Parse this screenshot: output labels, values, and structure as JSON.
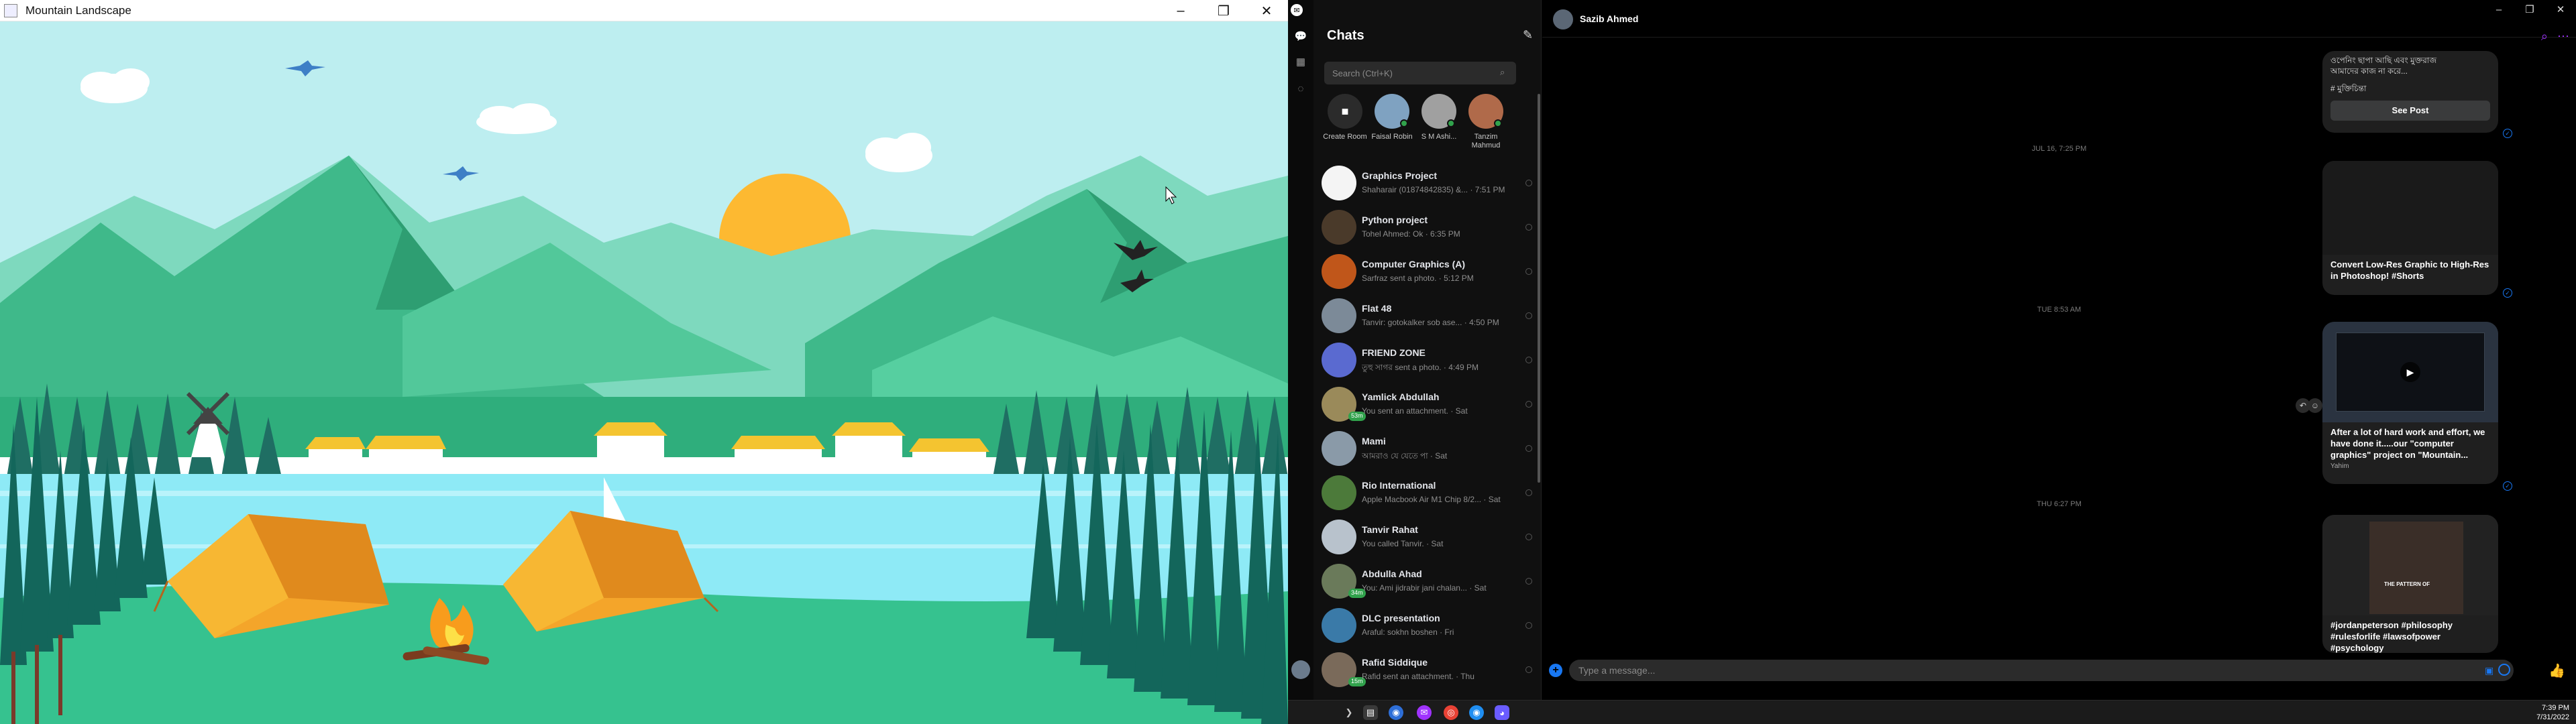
{
  "left_window": {
    "title": "Mountain Landscape",
    "controls": [
      "–",
      "❐",
      "✕"
    ]
  },
  "messenger": {
    "header_title": "Chats",
    "search_placeholder": "Search (Ctrl+K)",
    "stories": [
      {
        "label": "Create Room",
        "type": "create"
      },
      {
        "label": "Faisal Robin",
        "type": "person",
        "color": "#7fa2c1"
      },
      {
        "label": "S M Ashi...",
        "type": "person",
        "color": "#a0a0a0"
      },
      {
        "label": "Tanzim Mahmud",
        "type": "person",
        "color": "#b06a4a"
      }
    ],
    "conversations": [
      {
        "name": "Graphics Project",
        "preview": "Shaharair (01874842835) &... · 7:51 PM",
        "color": "#f4f4f4",
        "badge": ""
      },
      {
        "name": "Python project",
        "preview": "Tohel Ahmed: Ok · 6:35 PM",
        "color": "#4a3a2a",
        "badge": ""
      },
      {
        "name": "Computer Graphics (A)",
        "preview": "Sarfraz sent a photo. · 5:12 PM",
        "color": "#c0561a",
        "badge": ""
      },
      {
        "name": "Flat 48",
        "preview": "Tanvir: gotokalker sob ase... · 4:50 PM",
        "color": "#7c8a98",
        "badge": ""
      },
      {
        "name": "FRIEND ZONE",
        "preview": "তুহু সাগর sent a photo. · 4:49 PM",
        "color": "#5a6ad0",
        "badge": ""
      },
      {
        "name": "Yamlick Abdullah",
        "preview": "You sent an attachment. · Sat",
        "color": "#9a8a5a",
        "badge": "53m"
      },
      {
        "name": "Mami",
        "preview": "আমরাও যে যেতে পা · Sat",
        "color": "#8a9aa8",
        "badge": ""
      },
      {
        "name": "Rio International",
        "preview": "Apple Macbook Air M1 Chip 8/2... · Sat",
        "color": "#4c7a3a",
        "badge": ""
      },
      {
        "name": "Tanvir Rahat",
        "preview": "You called Tanvir. · Sat",
        "color": "#b8c2cc",
        "badge": ""
      },
      {
        "name": "Abdulla Ahad",
        "preview": "You: Ami jidrabir jani chalan... · Sat",
        "color": "#6a7a5a",
        "badge": "34m"
      },
      {
        "name": "DLC presentation",
        "preview": "Araful: sokhn boshen · Fri",
        "color": "#3a7aa8",
        "badge": ""
      },
      {
        "name": "Rafid Siddique",
        "preview": "Rafid sent an attachment. · Thu",
        "color": "#7a6a5a",
        "badge": "15m"
      }
    ],
    "conversation": {
      "contact_name": "Sazib Ahmed",
      "top_snippet_line1": "ওপেনিং ছাপা আছি এবং মুক্তরাজ",
      "top_snippet_line2": "আমাদের কাজ না করে...",
      "top_snippet_line3": "# মুক্তিচিন্তা",
      "see_post_label": "See Post",
      "timestamps": [
        "JUL 16, 7:25 PM",
        "TUE 8:53 AM",
        "THU 6:27 PM"
      ],
      "messages": [
        {
          "text": "Convert Low-Res Graphic to High-Res in Photoshop! #Shorts"
        },
        {
          "text": "After a lot of hard work and effort, we have done it.....our \"computer graphics\" project on \"Mountain...",
          "source": "Yahim"
        },
        {
          "text": "#jordanpeterson #philosophy #rulesforlife #lawsofpower #psychology",
          "overlay": "THE PATTERN OF"
        }
      ],
      "composer_placeholder": "Type a message..."
    }
  },
  "taskbar": {
    "time": "7:39 PM",
    "date": "7/31/2022"
  }
}
